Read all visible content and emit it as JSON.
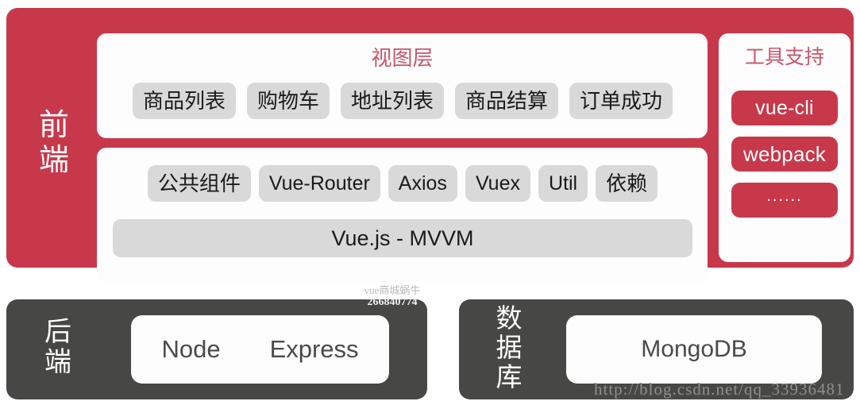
{
  "colors": {
    "red": "#c8384b",
    "red_title": "#c8566a",
    "dark": "#474745",
    "pill_gray": "#d9d9d9",
    "card_white": "#fdfdfd",
    "text_dark": "#1a1a1a"
  },
  "frontend": {
    "label_chars": [
      "前",
      "端"
    ],
    "view_layer": {
      "title": "视图层",
      "pills": [
        "商品列表",
        "购物车",
        "地址列表",
        "商品结算",
        "订单成功"
      ]
    },
    "logic_layer": {
      "pills": [
        "公共组件",
        "Vue-Router",
        "Axios",
        "Vuex",
        "Util",
        "依赖"
      ],
      "framework_bar": "Vue.js - MVVM"
    }
  },
  "tools": {
    "title": "工具支持",
    "buttons": [
      "vue-cli",
      "webpack",
      "......"
    ]
  },
  "backend": {
    "label_chars": [
      "后",
      "端"
    ],
    "items": [
      "Node",
      "Express"
    ]
  },
  "database": {
    "label_chars": [
      "数",
      "据",
      "库"
    ],
    "items": [
      "MongoDB"
    ]
  },
  "watermarks": {
    "center_line1": "vue商城蜗牛",
    "center_line2": "266840774",
    "csdn": "http://blog.csdn.net/qq_33936481"
  }
}
